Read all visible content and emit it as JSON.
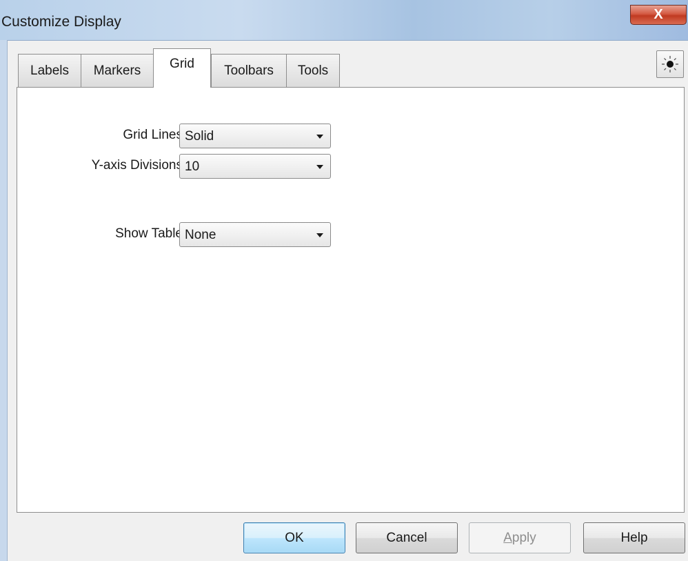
{
  "window": {
    "title": "Customize Display",
    "close_label": "X"
  },
  "tabs": [
    {
      "label": "Labels",
      "active": false
    },
    {
      "label": "Markers",
      "active": false
    },
    {
      "label": "Grid",
      "active": true
    },
    {
      "label": "Toolbars",
      "active": false
    },
    {
      "label": "Tools",
      "active": false
    }
  ],
  "theme_button": {
    "icon": "sun-icon"
  },
  "grid_panel": {
    "grid_lines": {
      "label": "Grid Lines",
      "value": "Solid"
    },
    "y_axis_divisions": {
      "label": "Y-axis Divisions",
      "value": "10"
    },
    "show_table": {
      "label": "Show Table",
      "value": "None"
    }
  },
  "buttons": {
    "ok": "OK",
    "cancel": "Cancel",
    "apply_accel": "A",
    "apply_rest": "pply",
    "help": "Help"
  },
  "colors": {
    "titlebar": "#b9d1ea",
    "close": "#c84a33",
    "default_button": "#bee6fd"
  }
}
